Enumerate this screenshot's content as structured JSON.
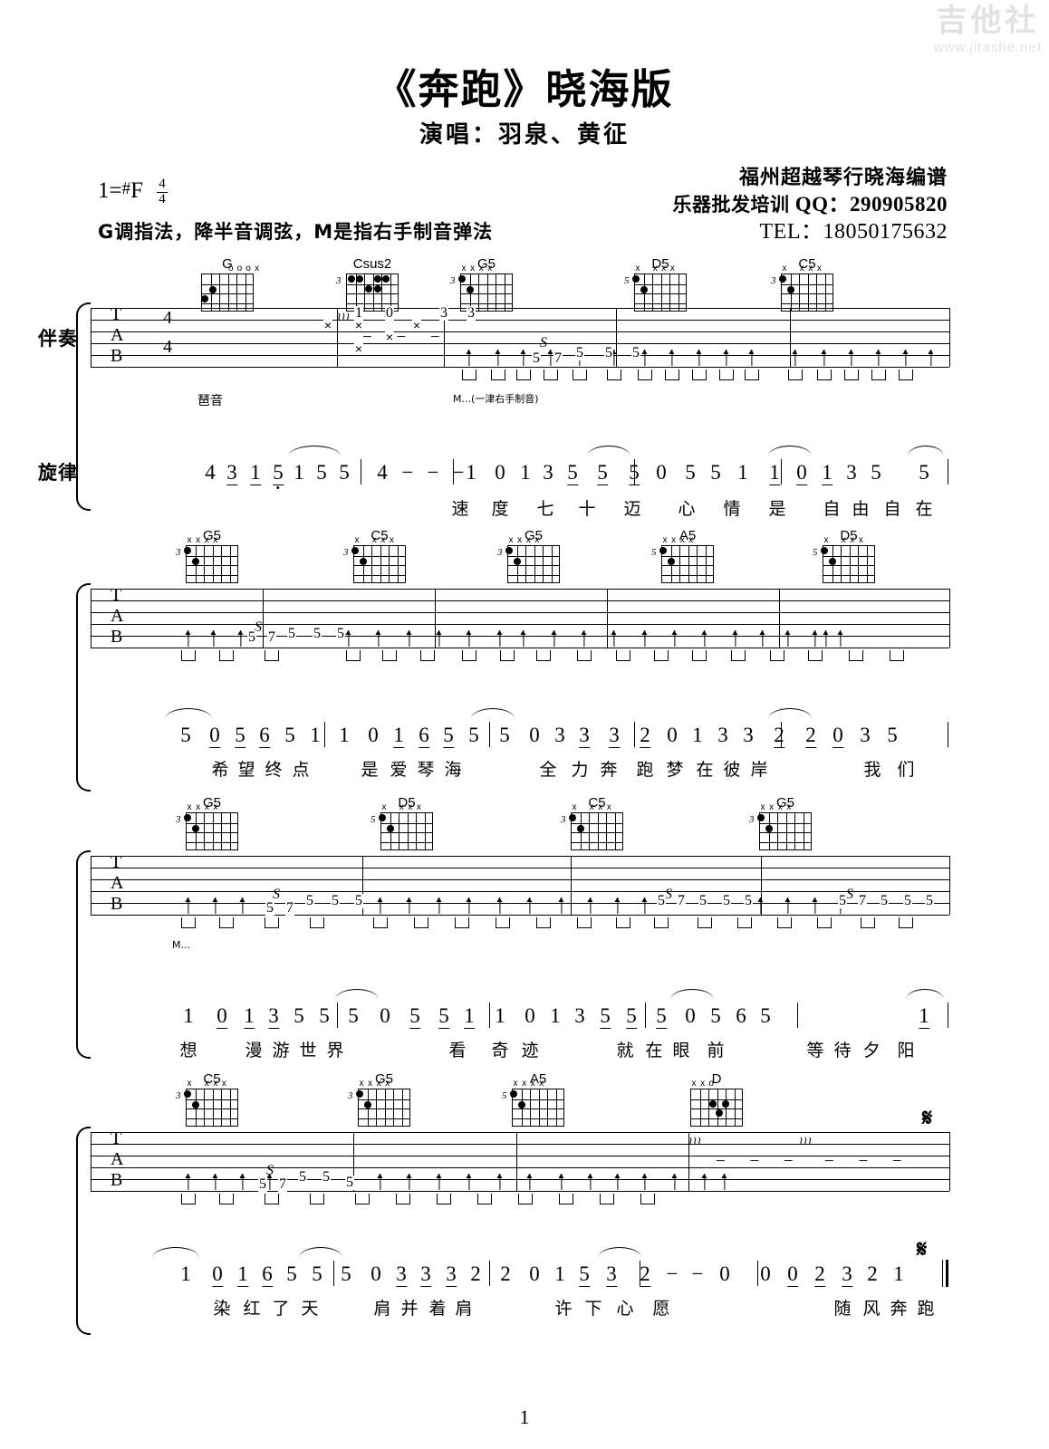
{
  "watermark": {
    "text": "吉他社",
    "url": "www.jitashe.net"
  },
  "header": {
    "title": "《奔跑》晓海版",
    "subtitle": "演唱：羽泉、黄征",
    "key_label": "1=",
    "key_sharp": "#",
    "key_note": "F",
    "time_num": "4",
    "time_den": "4",
    "play_note": "G调指法，降半音调弦，M是指右手制音弹法",
    "credit_line1": "福州超越琴行晓海编谱",
    "credit_line2_cn": "乐器批发培训",
    "credit_line2_en": "QQ：290905820",
    "credit_line3": "TEL：18050175632"
  },
  "page_number": "1",
  "staff_labels": {
    "accompaniment": "伴奏",
    "melody": "旋律"
  },
  "tab_clef": {
    "t": "T",
    "a": "A",
    "b": "B"
  },
  "annotations": {
    "arpeggio": "琶音",
    "mute_full": "M...(一津右手制音)",
    "mute_short": "M..."
  },
  "systems": [
    {
      "chords": [
        {
          "name": "G",
          "base": "",
          "marks": [
            "",
            "",
            "",
            "o",
            "o",
            "o",
            "x"
          ]
        },
        {
          "name": "Csus2",
          "base": "3",
          "marks": []
        },
        {
          "name": "G5",
          "base": "3",
          "marks": [
            "x",
            "x",
            "x",
            "x"
          ]
        },
        {
          "name": "D5",
          "base": "5",
          "marks": [
            "x",
            "",
            "x",
            "x",
            "x"
          ]
        },
        {
          "name": "C5",
          "base": "3",
          "marks": [
            "x",
            "",
            "x",
            "x",
            "x"
          ]
        }
      ],
      "melody_notes": [
        "4",
        "3",
        "1",
        "5",
        "1",
        "5",
        "5",
        "4",
        "-",
        "-",
        "-",
        "1",
        "0",
        "1",
        "3",
        "5",
        "5",
        "5",
        "0",
        "5",
        "5",
        "1",
        "1",
        "0",
        "1",
        "3",
        "5",
        "5"
      ],
      "lyrics": [
        "速",
        "度",
        "七",
        "十",
        "迈",
        "心",
        "情",
        "是",
        "自",
        "由",
        "自",
        "在"
      ]
    },
    {
      "chords": [
        {
          "name": "G5",
          "base": "3",
          "marks": [
            "x",
            "x",
            "x",
            "x"
          ]
        },
        {
          "name": "C5",
          "base": "3",
          "marks": [
            "x",
            "",
            "x",
            "x",
            "x"
          ]
        },
        {
          "name": "G5",
          "base": "3",
          "marks": [
            "x",
            "x",
            "x",
            "x"
          ]
        },
        {
          "name": "A5",
          "base": "5",
          "marks": [
            "x",
            "x",
            "x",
            "x"
          ]
        },
        {
          "name": "D5",
          "base": "5",
          "marks": [
            "x",
            "",
            "x",
            "x",
            "x"
          ]
        }
      ],
      "melody_notes": [
        "5",
        "0",
        "5",
        "6",
        "5",
        "1",
        "1",
        "0",
        "1",
        "6",
        "5",
        "5",
        "5",
        "0",
        "3",
        "3",
        "3",
        "2",
        "0",
        "1",
        "3",
        "3",
        "2",
        "2",
        "0",
        "3",
        "5"
      ],
      "lyrics": [
        "希",
        "望",
        "终",
        "点",
        "是",
        "爱",
        "琴",
        "海",
        "全",
        "力",
        "奔",
        "跑",
        "梦",
        "在",
        "彼",
        "岸",
        "我",
        "们"
      ]
    },
    {
      "chords": [
        {
          "name": "G5",
          "base": "3",
          "marks": [
            "x",
            "x",
            "x",
            "x"
          ]
        },
        {
          "name": "D5",
          "base": "5",
          "marks": [
            "x",
            "",
            "x",
            "x",
            "x"
          ]
        },
        {
          "name": "C5",
          "base": "3",
          "marks": [
            "x",
            "",
            "x",
            "x",
            "x"
          ]
        },
        {
          "name": "G5",
          "base": "3",
          "marks": [
            "x",
            "x",
            "x",
            "x"
          ]
        }
      ],
      "melody_notes": [
        "1",
        "0",
        "1",
        "3",
        "5",
        "5",
        "5",
        "0",
        "5",
        "5",
        "1",
        "1",
        "0",
        "1",
        "3",
        "5",
        "5",
        "5",
        "0",
        "5",
        "6",
        "5",
        "1"
      ],
      "lyrics": [
        "想",
        "漫",
        "游",
        "世",
        "界",
        "看",
        "奇",
        "迹",
        "就",
        "在",
        "眼",
        "前",
        "等",
        "待",
        "夕",
        "阳"
      ]
    },
    {
      "chords": [
        {
          "name": "C5",
          "base": "3",
          "marks": [
            "x",
            "",
            "x",
            "x",
            "x"
          ]
        },
        {
          "name": "G5",
          "base": "3",
          "marks": [
            "x",
            "x",
            "x",
            "x"
          ]
        },
        {
          "name": "A5",
          "base": "5",
          "marks": [
            "x",
            "x",
            "x",
            "x"
          ]
        },
        {
          "name": "D",
          "base": "",
          "marks": [
            "x",
            "x",
            "o"
          ]
        }
      ],
      "melody_notes": [
        "1",
        "0",
        "1",
        "6",
        "5",
        "5",
        "5",
        "0",
        "3",
        "3",
        "3",
        "2",
        "2",
        "0",
        "1",
        "5",
        "3",
        "2",
        "-",
        "-",
        "0",
        "0",
        "0",
        "2",
        "3",
        "2",
        "1"
      ],
      "lyrics": [
        "染",
        "红",
        "了",
        "天",
        "肩",
        "并",
        "着",
        "肩",
        "许",
        "下",
        "心",
        "愿",
        "随",
        "风",
        "奔",
        "跑"
      ]
    }
  ],
  "tab_marks": {
    "slide_s": "S",
    "intro_frets": [
      "1",
      "0",
      "3",
      "3"
    ],
    "riff_frets": [
      "5",
      "7",
      "5",
      "5",
      "5"
    ]
  }
}
